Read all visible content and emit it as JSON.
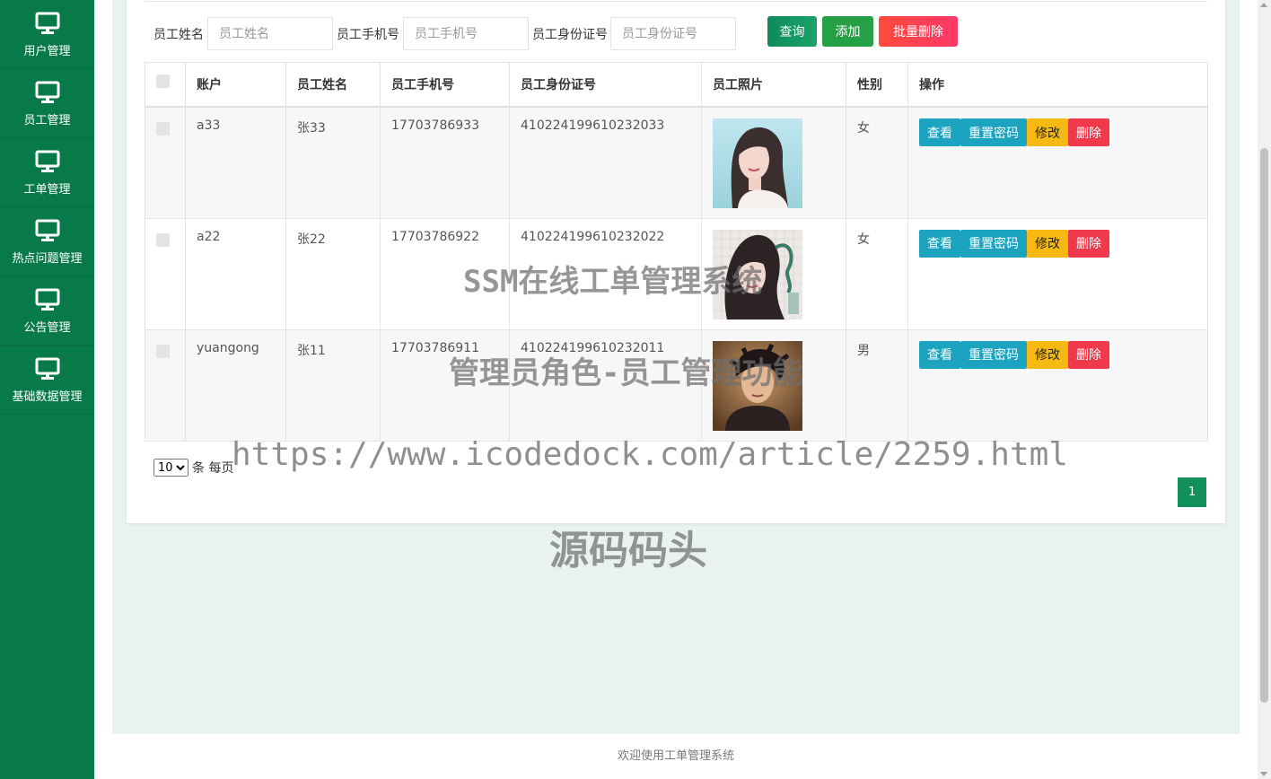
{
  "sidebar": {
    "items": [
      {
        "label": "用户管理",
        "icon": "monitor-icon"
      },
      {
        "label": "员工管理",
        "icon": "monitor-icon"
      },
      {
        "label": "工单管理",
        "icon": "monitor-icon"
      },
      {
        "label": "热点问题管理",
        "icon": "monitor-icon"
      },
      {
        "label": "公告管理",
        "icon": "monitor-icon"
      },
      {
        "label": "基础数据管理",
        "icon": "monitor-icon"
      }
    ]
  },
  "search": {
    "name_label": "员工姓名",
    "name_placeholder": "员工姓名",
    "phone_label": "员工手机号",
    "phone_placeholder": "员工手机号",
    "id_label": "员工身份证号",
    "id_placeholder": "员工身份证号",
    "query_button": "查询",
    "add_button": "添加",
    "bulk_delete_button": "批量删除"
  },
  "table": {
    "headers": [
      "账户",
      "员工姓名",
      "员工手机号",
      "员工身份证号",
      "员工照片",
      "性别",
      "操作"
    ],
    "rows": [
      {
        "account": "a33",
        "name": "张33",
        "phone": "17703786933",
        "id_number": "410224199610232033",
        "gender": "女"
      },
      {
        "account": "a22",
        "name": "张22",
        "phone": "17703786922",
        "id_number": "410224199610232022",
        "gender": "女"
      },
      {
        "account": "yuangong",
        "name": "张11",
        "phone": "17703786911",
        "id_number": "410224199610232011",
        "gender": "男"
      }
    ],
    "actions": {
      "view": "查看",
      "reset_password": "重置密码",
      "edit": "修改",
      "delete": "删除"
    }
  },
  "pagination": {
    "page_size": "10",
    "page_size_suffix": "条 每页",
    "current_page": "1"
  },
  "footer": {
    "text": "欢迎使用工单管理系统"
  },
  "watermarks": {
    "line1": "SSM在线工单管理系统",
    "line2": "管理员角色-员工管理功能",
    "line3": "https://www.icodedock.com/article/2259.html",
    "line4": "源码码头"
  },
  "colors": {
    "sidebar": "#087a4a",
    "accent": "#11905c",
    "info": "#1ba3bf",
    "warning": "#f6b911",
    "danger": "#f03a4c"
  }
}
